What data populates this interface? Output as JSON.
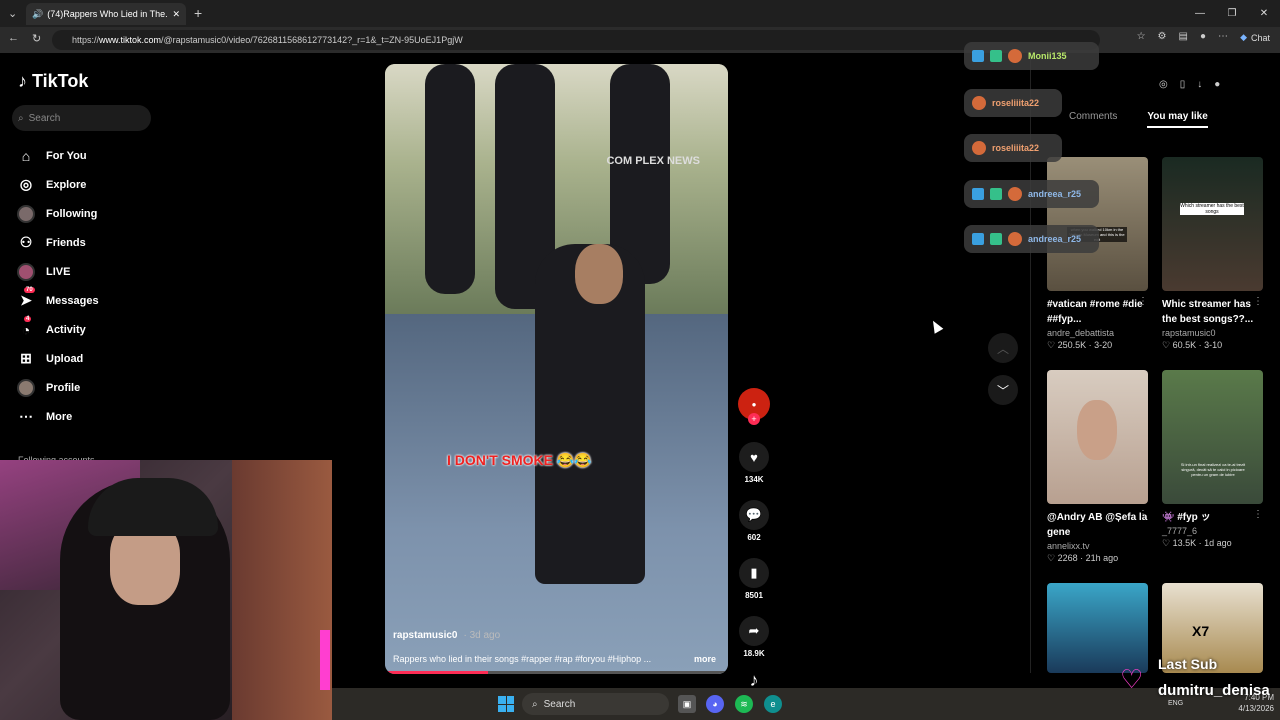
{
  "browser": {
    "tab_title": "(74)Rappers Who Lied in The...",
    "url_prefix": "https://",
    "url_host": "www.tiktok.com",
    "url_path": "/@rapstamusic0/video/7626811568612773142?_r=1&_t=ZN-95UoEJ1PgjW",
    "chat_label": "Chat"
  },
  "sidebar": {
    "logo_text": "TikTok",
    "search_placeholder": "Search",
    "items": [
      {
        "label": "For You",
        "icon": "home-icon"
      },
      {
        "label": "Explore",
        "icon": "compass-icon"
      },
      {
        "label": "Following",
        "icon": "avatar"
      },
      {
        "label": "Friends",
        "icon": "friends-icon"
      },
      {
        "label": "LIVE",
        "icon": "avatar"
      },
      {
        "label": "Messages",
        "icon": "send-icon",
        "badge": "70"
      },
      {
        "label": "Activity",
        "icon": "bell-icon",
        "badge": "4"
      },
      {
        "label": "Upload",
        "icon": "plus-square-icon"
      },
      {
        "label": "Profile",
        "icon": "avatar"
      },
      {
        "label": "More",
        "icon": "dots-icon"
      }
    ],
    "following_accounts": "Following accounts"
  },
  "video": {
    "caption_overlay": "I DON'T SMOKE 😂😂",
    "author": "rapstamusic0",
    "time_ago": "· 3d ago",
    "description": "Rappers who lied in their songs #rapper #rap #foryou #Hiphop ...",
    "more_label": "more",
    "watermark": "COM PLEX NEWS",
    "progress_fraction": 0.3
  },
  "actions": {
    "likes": "134K",
    "comments": "602",
    "saves": "8501",
    "shares": "18.9K"
  },
  "chat": [
    {
      "name": "Monii135",
      "style": "n-gr"
    },
    {
      "name": "roseliiita22",
      "style": "n-or"
    },
    {
      "name": "roseliiita22",
      "style": "n-or"
    },
    {
      "name": "andreea_r25",
      "style": "n-bl"
    },
    {
      "name": "andreea_r25",
      "style": "n-bl"
    }
  ],
  "right_panel": {
    "tab_comments": "Comments",
    "tab_you_may_like": "You may like",
    "cards": [
      {
        "title": "#vatican #rome #die ##fyp...",
        "author": "andre_debattista",
        "likes": "250.5K",
        "date": "3-20",
        "thumb_text": "when you walked 10km in the Vatican Museum and this is the exit"
      },
      {
        "title": "Whic streamer has the best songs??...",
        "author": "rapstamusic0",
        "likes": "60.5K",
        "date": "3-10",
        "thumb_text": "Which streamer has the best songs"
      },
      {
        "title": "@Andry AB @Șefa la gene",
        "author": "annelixx.tv",
        "likes": "2268",
        "date": "21h ago",
        "thumb_text": ""
      },
      {
        "title": "👾 #fyp ッ",
        "author": "_7777_6",
        "likes": "13.5K",
        "date": "1d ago",
        "thumb_text": "Si intr-un final realizezi ca te-ai trezit singură, decât să te calci in picioare pentru un gram de iubire"
      },
      {
        "title": "",
        "author": "",
        "likes": "",
        "date": "",
        "thumb_text": ""
      },
      {
        "title": "",
        "author": "",
        "likes": "",
        "date": "",
        "thumb_text": "X7"
      }
    ]
  },
  "taskbar": {
    "search_label": "Search",
    "lang": "ENG",
    "time": "7:40 PM",
    "date": "4/13/2026"
  },
  "stream_overlay": {
    "label": "Last Sub",
    "name": "dumitru_denisa"
  },
  "colors": {
    "accent": "#fe2c55",
    "background": "#000000",
    "chat_pill": "#3c3c3c"
  }
}
